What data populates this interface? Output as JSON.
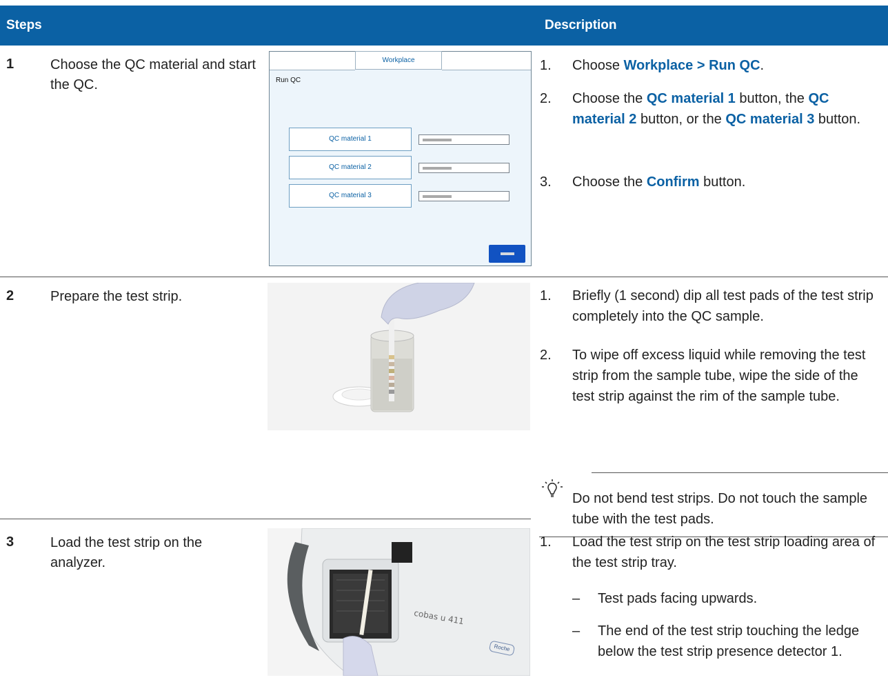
{
  "header": {
    "steps": "Steps",
    "description": "Description"
  },
  "steps": [
    {
      "number": "1",
      "title": "Choose the QC material and start the QC.",
      "ui": {
        "tab": "Workplace",
        "screen_title": "Run QC",
        "buttons": [
          "QC material 1",
          "QC material 2",
          "QC material 3"
        ]
      },
      "items": [
        {
          "n": "1.",
          "parts": [
            "Choose ",
            "Workplace > Run QC",
            "."
          ]
        },
        {
          "n": "2.",
          "parts": [
            "Choose the ",
            "QC material 1",
            " button, the ",
            "QC material 2",
            " button, or the ",
            "QC material 3",
            " button."
          ]
        },
        {
          "n": "3.",
          "parts": [
            "Choose the ",
            "Confirm",
            " button."
          ]
        }
      ]
    },
    {
      "number": "2",
      "title": "Prepare the test strip.",
      "items": [
        {
          "n": "1.",
          "text": "Briefly (1 second) dip all test pads of the test strip completely into the QC sample."
        },
        {
          "n": "2.",
          "text": "To wipe off excess liquid while removing the test strip from the sample tube, wipe the side of the test strip against the rim of the sample tube."
        }
      ],
      "tip": "Do not bend test strips. Do not touch the sample tube with the test pads."
    },
    {
      "number": "3",
      "title": "Load the test strip on the analyzer.",
      "photo_labels": {
        "brand": "cobas u 411",
        "logo": "Roche"
      },
      "items": [
        {
          "n": "1.",
          "text": "Load the test strip on the test strip loading area of the test strip tray."
        }
      ],
      "subitems": [
        {
          "dash": "–",
          "text": "Test pads facing upwards."
        },
        {
          "dash": "–",
          "text": "The end of the test strip touching the ledge below the test strip presence detector 1."
        }
      ]
    }
  ],
  "icons": {
    "tip": "lightbulb-icon"
  },
  "colors": {
    "header_bg": "#0b61a4",
    "highlight": "#0b61a4",
    "confirm_button": "#1152c2"
  }
}
